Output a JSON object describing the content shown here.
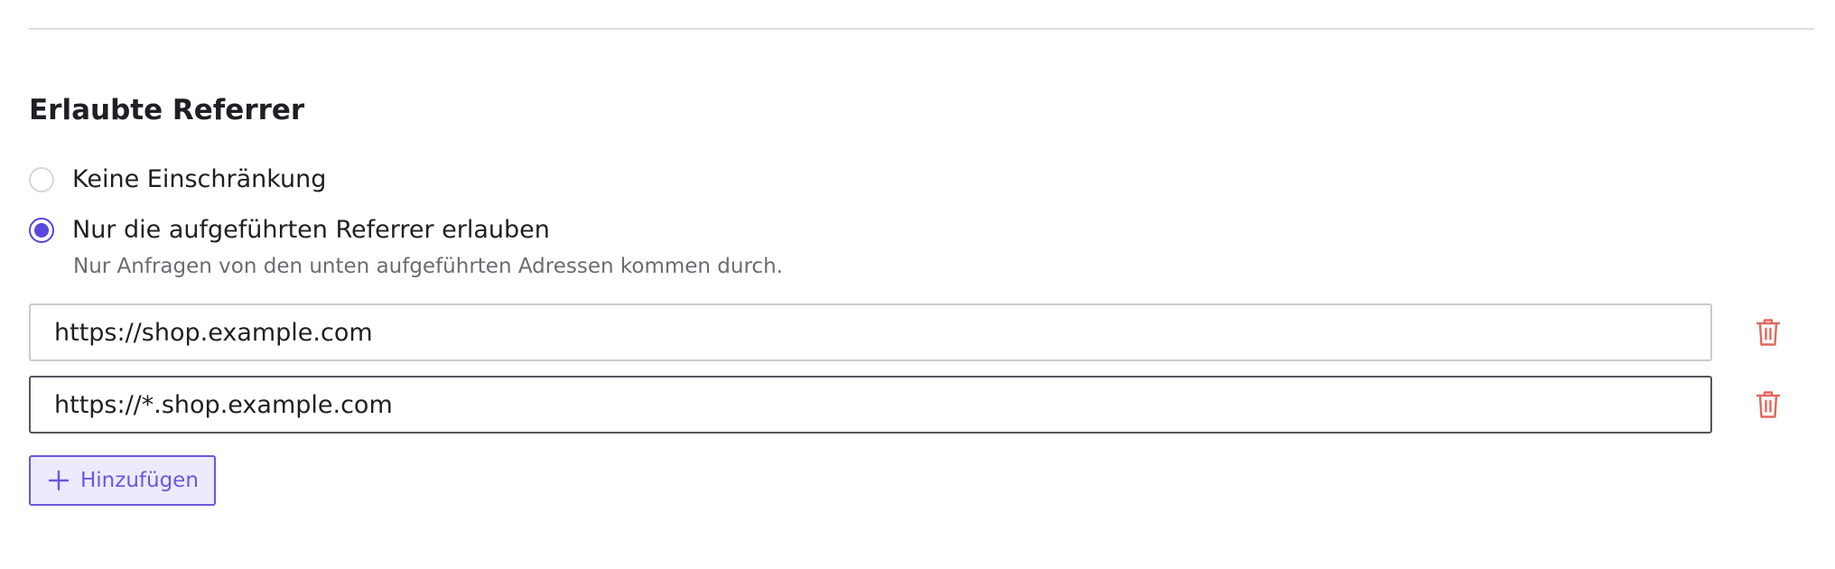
{
  "section": {
    "title": "Erlaubte Referrer"
  },
  "radio_options": [
    {
      "label": "Keine Einschränkung",
      "selected": false
    },
    {
      "label": "Nur die aufgeführten Referrer erlauben",
      "selected": true,
      "hint": "Nur Anfragen von den unten aufgeführten Adressen kommen durch."
    }
  ],
  "referrers": [
    {
      "value": "https://shop.example.com",
      "delete_icon": "trash-icon"
    },
    {
      "value": "https://*.shop.example.com",
      "delete_icon": "trash-icon"
    }
  ],
  "add_button": {
    "label": "Hinzufügen",
    "icon": "plus-icon"
  },
  "colors": {
    "accent": "#5a45dd",
    "delete": "#e0685f",
    "add_button_bg": "#ecebfd"
  }
}
